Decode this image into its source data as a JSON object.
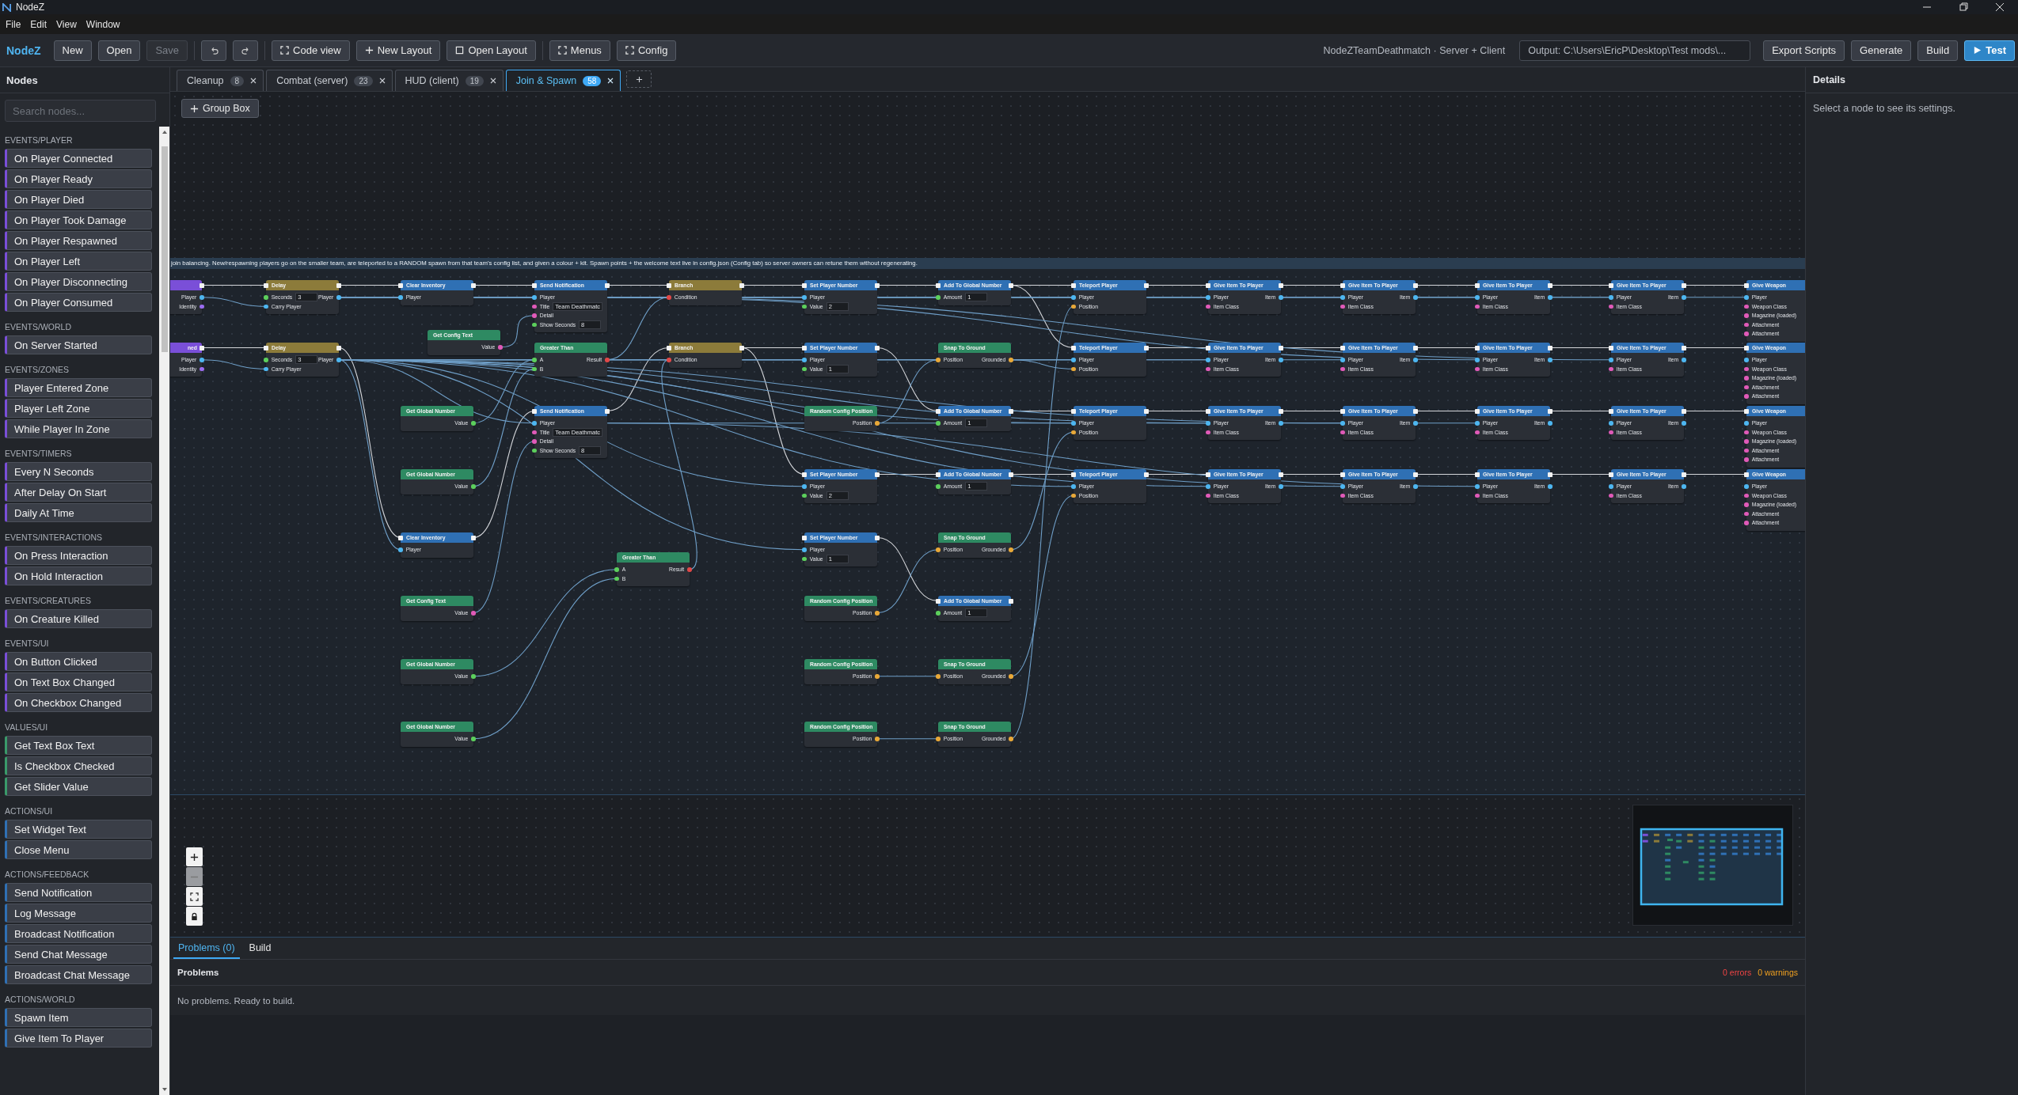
{
  "window": {
    "title": "NodeZ",
    "menu": [
      "File",
      "Edit",
      "View",
      "Window"
    ]
  },
  "toolbar": {
    "brand": "NodeZ",
    "file_buttons": [
      {
        "label": "New",
        "disabled": false
      },
      {
        "label": "Open",
        "disabled": false
      },
      {
        "label": "Save",
        "disabled": true
      }
    ],
    "layout_buttons": [
      {
        "label": "Code view",
        "kind": "frame"
      },
      {
        "label": "New Layout",
        "kind": "plus"
      },
      {
        "label": "Open Layout",
        "kind": "square"
      }
    ],
    "menu_buttons": [
      {
        "label": "Menus",
        "kind": "frame"
      },
      {
        "label": "Config",
        "kind": "frame"
      }
    ],
    "project": "NodeZTeamDeathmatch · Server + Client",
    "output": "Output: C:\\Users\\EricP\\Desktop\\Test mods\\...",
    "actions": [
      {
        "label": "Export Scripts",
        "primary": false
      },
      {
        "label": "Generate",
        "primary": false
      },
      {
        "label": "Build",
        "primary": false
      },
      {
        "label": "Test",
        "primary": true
      }
    ]
  },
  "sidebar": {
    "title": "Nodes",
    "search": {
      "placeholder": "Search nodes..."
    },
    "sections": [
      {
        "label": "EVENTS/PLAYER",
        "kind": "event",
        "items": [
          "On Player Connected",
          "On Player Ready",
          "On Player Died",
          "On Player Took Damage",
          "On Player Respawned",
          "On Player Left",
          "On Player Disconnecting",
          "On Player Consumed"
        ]
      },
      {
        "label": "EVENTS/WORLD",
        "kind": "event",
        "items": [
          "On Server Started"
        ]
      },
      {
        "label": "EVENTS/ZONES",
        "kind": "event",
        "items": [
          "Player Entered Zone",
          "Player Left Zone",
          "While Player In Zone"
        ]
      },
      {
        "label": "EVENTS/TIMERS",
        "kind": "event",
        "items": [
          "Every N Seconds",
          "After Delay On Start",
          "Daily At Time"
        ]
      },
      {
        "label": "EVENTS/INTERACTIONS",
        "kind": "event",
        "items": [
          "On Press Interaction",
          "On Hold Interaction"
        ]
      },
      {
        "label": "EVENTS/CREATURES",
        "kind": "event",
        "items": [
          "On Creature Killed"
        ]
      },
      {
        "label": "EVENTS/UI",
        "kind": "event",
        "items": [
          "On Button Clicked",
          "On Text Box Changed",
          "On Checkbox Changed"
        ]
      },
      {
        "label": "VALUES/UI",
        "kind": "value",
        "items": [
          "Get Text Box Text",
          "Is Checkbox Checked",
          "Get Slider Value"
        ]
      },
      {
        "label": "ACTIONS/UI",
        "kind": "action",
        "items": [
          "Set Widget Text",
          "Close Menu"
        ]
      },
      {
        "label": "ACTIONS/FEEDBACK",
        "kind": "action",
        "items": [
          "Send Notification",
          "Log Message",
          "Broadcast Notification",
          "Send Chat Message",
          "Broadcast Chat Message"
        ]
      },
      {
        "label": "ACTIONS/WORLD",
        "kind": "action",
        "items": [
          "Spawn Item",
          "Give Item To Player"
        ]
      }
    ]
  },
  "tabs": [
    {
      "label": "Cleanup",
      "count": "8",
      "selected": false
    },
    {
      "label": "Combat (server)",
      "count": "23",
      "selected": false
    },
    {
      "label": "HUD (client)",
      "count": "19",
      "selected": false
    },
    {
      "label": "Join & Spawn",
      "count": "58",
      "selected": true
    }
  ],
  "canvas": {
    "group_button": "Group Box",
    "group_comment": "join balancing. New/respawning players go on the smaller team, are teleported to a RANDOM spawn from that team's config list, and given a colour + kit. Spawn points + the welcome text live in config.json (Config tab) so server owners can retune them without regenerating.",
    "nodes": [
      {
        "kind": "event",
        "outputs": [
          {
            "label": "Player",
            "kind": "player"
          },
          {
            "label": "Identity",
            "kind": "identity"
          }
        ]
      },
      {
        "title": "Delay",
        "kind": "flow",
        "inputs": [
          {
            "label": "Seconds",
            "kind": "number",
            "value": "3"
          },
          {
            "label": "Carry Player",
            "kind": "player"
          }
        ],
        "outputs": [
          {
            "label": "Player",
            "kind": "player"
          }
        ]
      },
      {
        "title": "Clear Inventory",
        "kind": "action",
        "inputs": [
          {
            "label": "Player",
            "kind": "player"
          }
        ]
      },
      {
        "title": "Send Notification",
        "kind": "action",
        "inputs": [
          {
            "label": "Player",
            "kind": "player"
          },
          {
            "label": "Title",
            "kind": "text",
            "value": "Team Deathmatc"
          },
          {
            "label": "Detail",
            "kind": "text"
          },
          {
            "label": "Show Seconds",
            "kind": "number",
            "value": "8"
          }
        ]
      },
      {
        "title": "Branch",
        "kind": "flow",
        "inputs": [
          {
            "label": "Condition",
            "kind": "bool"
          }
        ]
      },
      {
        "title": "Set Player Number",
        "kind": "action",
        "inputs": [
          {
            "label": "Player",
            "kind": "player"
          },
          {
            "label": "Value",
            "kind": "number",
            "value": "2"
          }
        ]
      },
      {
        "title": "Add To Global Number",
        "kind": "action",
        "inputs": [
          {
            "label": "Amount",
            "kind": "number",
            "value": "1"
          }
        ]
      },
      {
        "title": "Teleport Player",
        "kind": "action",
        "inputs": [
          {
            "label": "Player",
            "kind": "player"
          },
          {
            "label": "Position",
            "kind": "vector"
          }
        ]
      },
      {
        "title": "Give Item To Player",
        "kind": "action",
        "inputs": [
          {
            "label": "Player",
            "kind": "player"
          },
          {
            "label": "Item Class",
            "kind": "text"
          }
        ],
        "outputs": [
          {
            "label": "Item",
            "kind": "item"
          }
        ]
      },
      {
        "title": "Give Item To Player",
        "kind": "action",
        "inputs": [
          {
            "label": "Player",
            "kind": "player"
          },
          {
            "label": "Item Class",
            "kind": "text"
          }
        ],
        "outputs": [
          {
            "label": "Item",
            "kind": "item"
          }
        ]
      },
      {
        "title": "Give Item To Player",
        "kind": "action",
        "inputs": [
          {
            "label": "Player",
            "kind": "player"
          },
          {
            "label": "Item Class",
            "kind": "text"
          }
        ],
        "outputs": [
          {
            "label": "Item",
            "kind": "item"
          }
        ]
      },
      {
        "title": "Give Item To Player",
        "kind": "action",
        "inputs": [
          {
            "label": "Player",
            "kind": "player"
          },
          {
            "label": "Item Class",
            "kind": "text"
          }
        ],
        "outputs": [
          {
            "label": "Item",
            "kind": "item"
          }
        ]
      },
      {
        "title": "Give Weapon",
        "kind": "action",
        "inputs": [
          {
            "label": "Player",
            "kind": "player"
          },
          {
            "label": "Weapon Class",
            "kind": "text"
          },
          {
            "label": "Magazine (loaded)",
            "kind": "text"
          },
          {
            "label": "Attachment",
            "kind": "text"
          },
          {
            "label": "Attachment",
            "kind": "text"
          }
        ]
      },
      {
        "title": "Get Config Text",
        "kind": "value",
        "outputs": [
          {
            "label": "Value",
            "kind": "text"
          }
        ]
      },
      {
        "title": "ned",
        "kind": "event",
        "outputs": [
          {
            "label": "Player",
            "kind": "player"
          },
          {
            "label": "Identity",
            "kind": "identity"
          }
        ]
      },
      {
        "title": "Delay",
        "kind": "flow",
        "inputs": [
          {
            "label": "Seconds",
            "kind": "number",
            "value": "3"
          },
          {
            "label": "Carry Player",
            "kind": "player"
          }
        ],
        "outputs": [
          {
            "label": "Player",
            "kind": "player"
          }
        ]
      },
      {
        "title": "Greater Than",
        "kind": "value",
        "inputs": [
          {
            "label": "A",
            "kind": "number"
          },
          {
            "label": "B",
            "kind": "number"
          }
        ],
        "outputs": [
          {
            "label": "Result",
            "kind": "bool"
          }
        ]
      },
      {
        "title": "Branch",
        "kind": "flow",
        "inputs": [
          {
            "label": "Condition",
            "kind": "bool"
          }
        ]
      },
      {
        "title": "Set Player Number",
        "kind": "action",
        "inputs": [
          {
            "label": "Player",
            "kind": "player"
          },
          {
            "label": "Value",
            "kind": "number",
            "value": "1"
          }
        ]
      },
      {
        "title": "Snap To Ground",
        "kind": "value",
        "inputs": [
          {
            "label": "Position",
            "kind": "vector"
          }
        ],
        "outputs": [
          {
            "label": "Grounded",
            "kind": "vector"
          }
        ]
      },
      {
        "title": "Teleport Player",
        "kind": "action",
        "inputs": [
          {
            "label": "Player",
            "kind": "player"
          },
          {
            "label": "Position",
            "kind": "vector"
          }
        ]
      },
      {
        "title": "Give Item To Player",
        "kind": "action",
        "inputs": [
          {
            "label": "Player",
            "kind": "player"
          },
          {
            "label": "Item Class",
            "kind": "text"
          }
        ],
        "outputs": [
          {
            "label": "Item",
            "kind": "item"
          }
        ]
      },
      {
        "title": "Give Item To Player",
        "kind": "action",
        "inputs": [
          {
            "label": "Player",
            "kind": "player"
          },
          {
            "label": "Item Class",
            "kind": "text"
          }
        ],
        "outputs": [
          {
            "label": "Item",
            "kind": "item"
          }
        ]
      },
      {
        "title": "Give Item To Player",
        "kind": "action",
        "inputs": [
          {
            "label": "Player",
            "kind": "player"
          },
          {
            "label": "Item Class",
            "kind": "text"
          }
        ],
        "outputs": [
          {
            "label": "Item",
            "kind": "item"
          }
        ]
      },
      {
        "title": "Give Item To Player",
        "kind": "action",
        "inputs": [
          {
            "label": "Player",
            "kind": "player"
          },
          {
            "label": "Item Class",
            "kind": "text"
          }
        ],
        "outputs": [
          {
            "label": "Item",
            "kind": "item"
          }
        ]
      },
      {
        "title": "Give Weapon",
        "kind": "action",
        "inputs": [
          {
            "label": "Player",
            "kind": "player"
          },
          {
            "label": "Weapon Class",
            "kind": "text"
          },
          {
            "label": "Magazine (loaded)",
            "kind": "text"
          },
          {
            "label": "Attachment",
            "kind": "text"
          },
          {
            "label": "Attachment",
            "kind": "text"
          }
        ]
      },
      {
        "title": "Get Global Number",
        "kind": "value",
        "outputs": [
          {
            "label": "Value",
            "kind": "number"
          }
        ]
      },
      {
        "title": "Send Notification",
        "kind": "action",
        "inputs": [
          {
            "label": "Player",
            "kind": "player"
          },
          {
            "label": "Title",
            "kind": "text",
            "value": "Team Deathmatc"
          },
          {
            "label": "Detail",
            "kind": "text"
          },
          {
            "label": "Show Seconds",
            "kind": "number",
            "value": "8"
          }
        ]
      },
      {
        "title": "Random Config Position",
        "kind": "value",
        "outputs": [
          {
            "label": "Position",
            "kind": "vector"
          }
        ]
      },
      {
        "title": "Add To Global Number",
        "kind": "action",
        "inputs": [
          {
            "label": "Amount",
            "kind": "number",
            "value": "1"
          }
        ]
      },
      {
        "title": "Teleport Player",
        "kind": "action",
        "inputs": [
          {
            "label": "Player",
            "kind": "player"
          },
          {
            "label": "Position",
            "kind": "vector"
          }
        ]
      },
      {
        "title": "Give Item To Player",
        "kind": "action",
        "inputs": [
          {
            "label": "Player",
            "kind": "player"
          },
          {
            "label": "Item Class",
            "kind": "text"
          }
        ],
        "outputs": [
          {
            "label": "Item",
            "kind": "item"
          }
        ]
      },
      {
        "title": "Give Item To Player",
        "kind": "action",
        "inputs": [
          {
            "label": "Player",
            "kind": "player"
          },
          {
            "label": "Item Class",
            "kind": "text"
          }
        ],
        "outputs": [
          {
            "label": "Item",
            "kind": "item"
          }
        ]
      },
      {
        "title": "Give Item To Player",
        "kind": "action",
        "inputs": [
          {
            "label": "Player",
            "kind": "player"
          },
          {
            "label": "Item Class",
            "kind": "text"
          }
        ],
        "outputs": [
          {
            "label": "Item",
            "kind": "item"
          }
        ]
      },
      {
        "title": "Give Item To Player",
        "kind": "action",
        "inputs": [
          {
            "label": "Player",
            "kind": "player"
          },
          {
            "label": "Item Class",
            "kind": "text"
          }
        ],
        "outputs": [
          {
            "label": "Item",
            "kind": "item"
          }
        ]
      },
      {
        "title": "Give Weapon",
        "kind": "action",
        "inputs": [
          {
            "label": "Player",
            "kind": "player"
          },
          {
            "label": "Weapon Class",
            "kind": "text"
          },
          {
            "label": "Magazine (loaded)",
            "kind": "text"
          },
          {
            "label": "Attachment",
            "kind": "text"
          },
          {
            "label": "Attachment",
            "kind": "text"
          }
        ]
      },
      {
        "title": "Get Global Number",
        "kind": "value",
        "outputs": [
          {
            "label": "Value",
            "kind": "number"
          }
        ]
      },
      {
        "title": "Set Player Number",
        "kind": "action",
        "inputs": [
          {
            "label": "Player",
            "kind": "player"
          },
          {
            "label": "Value",
            "kind": "number",
            "value": "2"
          }
        ]
      },
      {
        "title": "Add To Global Number",
        "kind": "action",
        "inputs": [
          {
            "label": "Amount",
            "kind": "number",
            "value": "1"
          }
        ]
      },
      {
        "title": "Teleport Player",
        "kind": "action",
        "inputs": [
          {
            "label": "Player",
            "kind": "player"
          },
          {
            "label": "Position",
            "kind": "vector"
          }
        ]
      },
      {
        "title": "Give Item To Player",
        "kind": "action",
        "inputs": [
          {
            "label": "Player",
            "kind": "player"
          },
          {
            "label": "Item Class",
            "kind": "text"
          }
        ],
        "outputs": [
          {
            "label": "Item",
            "kind": "item"
          }
        ]
      },
      {
        "title": "Give Item To Player",
        "kind": "action",
        "inputs": [
          {
            "label": "Player",
            "kind": "player"
          },
          {
            "label": "Item Class",
            "kind": "text"
          }
        ],
        "outputs": [
          {
            "label": "Item",
            "kind": "item"
          }
        ]
      },
      {
        "title": "Give Item To Player",
        "kind": "action",
        "inputs": [
          {
            "label": "Player",
            "kind": "player"
          },
          {
            "label": "Item Class",
            "kind": "text"
          }
        ],
        "outputs": [
          {
            "label": "Item",
            "kind": "item"
          }
        ]
      },
      {
        "title": "Give Item To Player",
        "kind": "action",
        "inputs": [
          {
            "label": "Player",
            "kind": "player"
          },
          {
            "label": "Item Class",
            "kind": "text"
          }
        ],
        "outputs": [
          {
            "label": "Item",
            "kind": "item"
          }
        ]
      },
      {
        "title": "Give Weapon",
        "kind": "action",
        "inputs": [
          {
            "label": "Player",
            "kind": "player"
          },
          {
            "label": "Weapon Class",
            "kind": "text"
          },
          {
            "label": "Magazine (loaded)",
            "kind": "text"
          },
          {
            "label": "Attachment",
            "kind": "text"
          },
          {
            "label": "Attachment",
            "kind": "text"
          }
        ]
      },
      {
        "title": "Clear Inventory",
        "kind": "action",
        "inputs": [
          {
            "label": "Player",
            "kind": "player"
          }
        ]
      },
      {
        "title": "Set Player Number",
        "kind": "action",
        "inputs": [
          {
            "label": "Player",
            "kind": "player"
          },
          {
            "label": "Value",
            "kind": "number",
            "value": "1"
          }
        ]
      },
      {
        "title": "Snap To Ground",
        "kind": "value",
        "inputs": [
          {
            "label": "Position",
            "kind": "vector"
          }
        ],
        "outputs": [
          {
            "label": "Grounded",
            "kind": "vector"
          }
        ]
      },
      {
        "title": "Greater Than",
        "kind": "value",
        "inputs": [
          {
            "label": "A",
            "kind": "number"
          },
          {
            "label": "B",
            "kind": "number"
          }
        ],
        "outputs": [
          {
            "label": "Result",
            "kind": "bool"
          }
        ]
      },
      {
        "title": "Get Config Text",
        "kind": "value",
        "outputs": [
          {
            "label": "Value",
            "kind": "text"
          }
        ]
      },
      {
        "title": "Random Config Position",
        "kind": "value",
        "outputs": [
          {
            "label": "Position",
            "kind": "vector"
          }
        ]
      },
      {
        "title": "Add To Global Number",
        "kind": "action",
        "inputs": [
          {
            "label": "Amount",
            "kind": "number",
            "value": "1"
          }
        ]
      },
      {
        "title": "Get Global Number",
        "kind": "value",
        "outputs": [
          {
            "label": "Value",
            "kind": "number"
          }
        ]
      },
      {
        "title": "Random Config Position",
        "kind": "value",
        "outputs": [
          {
            "label": "Position",
            "kind": "vector"
          }
        ]
      },
      {
        "title": "Snap To Ground",
        "kind": "value",
        "inputs": [
          {
            "label": "Position",
            "kind": "vector"
          }
        ],
        "outputs": [
          {
            "label": "Grounded",
            "kind": "vector"
          }
        ]
      },
      {
        "title": "Get Global Number",
        "kind": "value",
        "outputs": [
          {
            "label": "Value",
            "kind": "number"
          }
        ]
      },
      {
        "title": "Random Config Position",
        "kind": "value",
        "outputs": [
          {
            "label": "Position",
            "kind": "vector"
          }
        ]
      },
      {
        "title": "Snap To Ground",
        "kind": "value",
        "inputs": [
          {
            "label": "Position",
            "kind": "vector"
          }
        ],
        "outputs": [
          {
            "label": "Grounded",
            "kind": "vector"
          }
        ]
      }
    ],
    "zoom_controls": [
      {
        "kind": "zoom_in",
        "disabled": false
      },
      {
        "kind": "zoom_out",
        "disabled": true
      },
      {
        "kind": "fit",
        "disabled": false
      },
      {
        "kind": "lock",
        "disabled": false
      }
    ]
  },
  "details": {
    "title": "Details",
    "hint": "Select a node to see its settings."
  },
  "bottom": {
    "tabs": [
      {
        "label": "Problems (0)",
        "selected": true
      },
      {
        "label": "Build",
        "selected": false
      }
    ],
    "title": "Problems",
    "errors": "0 errors",
    "warnings": "0 warnings",
    "message": "No problems. Ready to build."
  }
}
